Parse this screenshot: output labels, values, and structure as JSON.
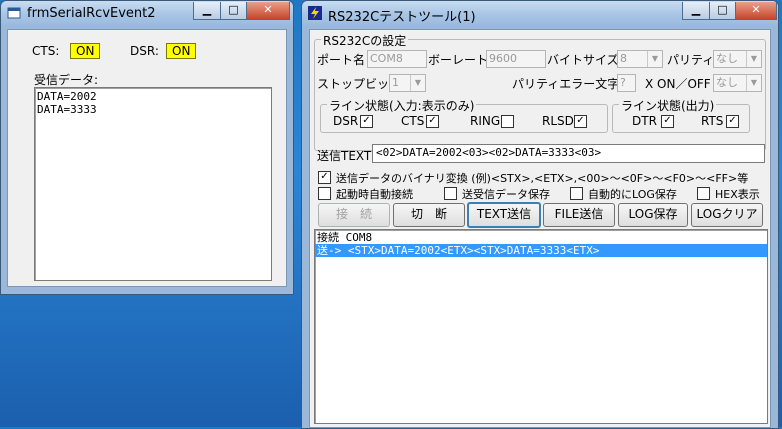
{
  "left_window": {
    "title": "frmSerialRcvEvent2",
    "cts_label": "CTS:",
    "cts_value": "ON",
    "dsr_label": "DSR:",
    "dsr_value": "ON",
    "recv_label": "受信データ:",
    "recv_lines": [
      "DATA=2002",
      "DATA=3333"
    ]
  },
  "right_window": {
    "title": "RS232Cテストツール(1)",
    "settings_group": "RS232Cの設定",
    "port_label": "ポート名",
    "port_value": "COM8",
    "baud_label": "ボーレート",
    "baud_value": "9600",
    "bytesize_label": "バイトサイズ",
    "bytesize_value": "8",
    "parity_label": "パリティ",
    "parity_value": "なし",
    "stopbit_label": "ストップビット",
    "stopbit_value": "1",
    "parity_err_label": "パリティエラー文字",
    "parity_err_value": "?",
    "xonoff_label": "X ON／OFF",
    "xonoff_value": "なし",
    "line_in_group": "ライン状態(入力:表示のみ)",
    "dsr": "DSR",
    "cts": "CTS",
    "ring": "RING",
    "rlsd": "RLSD",
    "line_out_group": "ライン状態(出力)",
    "dtr": "DTR",
    "rts": "RTS",
    "send_text_label": "送信TEXT",
    "send_text_value": "<02>DATA=2002<03><02>DATA=3333<03>",
    "binary_conv": "送信データのバイナリ変換 (例)<STX>,<ETX>,<00>～<0F>～<F0>～<FF>等",
    "auto_connect": "起動時自動接続",
    "save_send_recv": "送受信データ保存",
    "auto_log": "自動的にLOG保存",
    "hex_display": "HEX表示",
    "buttons": {
      "connect": "接　続",
      "disconnect": "切　断",
      "text_send": "TEXT送信",
      "file_send": "FILE送信",
      "log_save": "LOG保存",
      "log_clear": "LOGクリア"
    },
    "log_lines": [
      "接続 COM8",
      "送-> <STX>DATA=2002<ETX><STX>DATA=3333<ETX>"
    ]
  }
}
